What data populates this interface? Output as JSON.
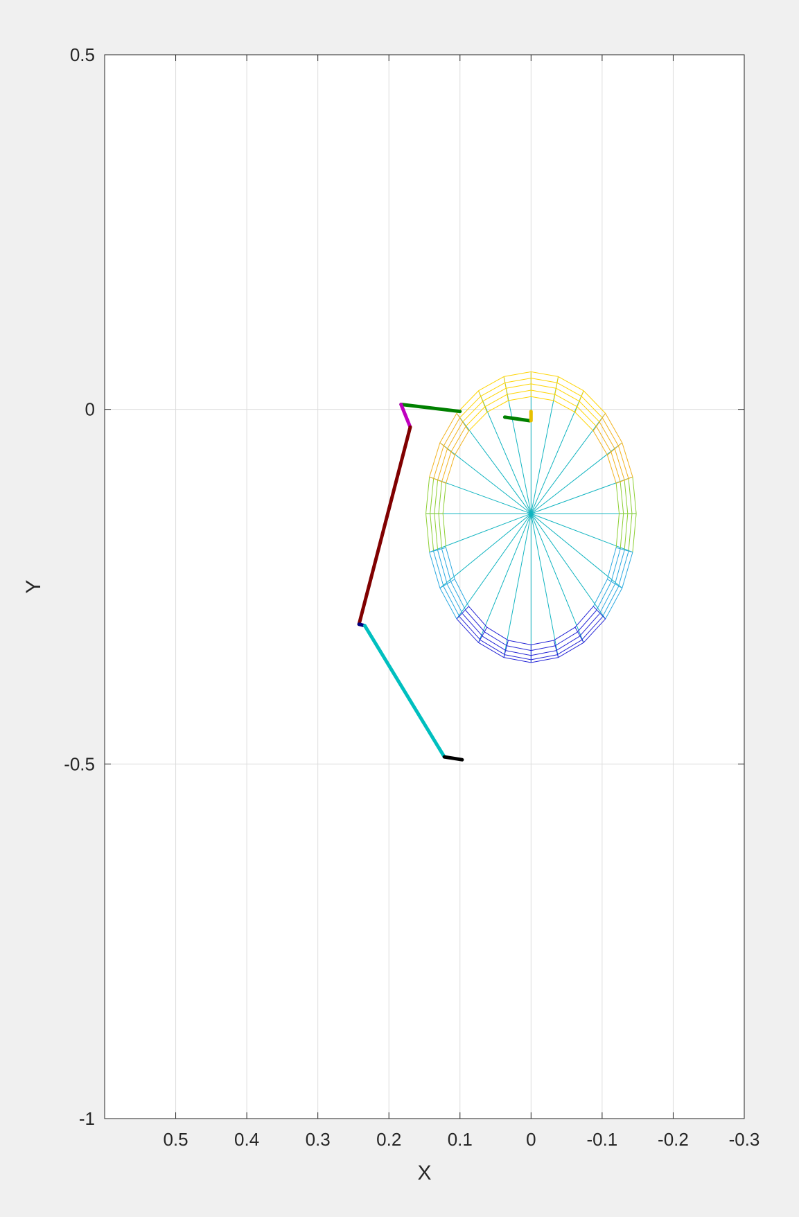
{
  "chart_data": {
    "type": "line",
    "xlabel": "X",
    "ylabel": "Y",
    "xlim": [
      -0.3,
      0.6
    ],
    "ylim": [
      -1,
      0.5
    ],
    "x_reversed": true,
    "x_ticks": [
      0.5,
      0.4,
      0.3,
      0.2,
      0.1,
      0,
      -0.1,
      -0.2,
      -0.3
    ],
    "x_tick_labels": [
      "0.5",
      "0.4",
      "0.3",
      "0.2",
      "0.1",
      "0",
      "-0.1",
      "-0.2",
      "-0.3"
    ],
    "y_ticks": [
      0.5,
      0,
      -0.5,
      -1
    ],
    "y_tick_labels": [
      "0.5",
      "0",
      "-0.5",
      "-1"
    ],
    "grid": true,
    "colors": {
      "background": "#f0f0f0",
      "axes": "#ffffff",
      "axis_line": "#262626",
      "grid": "#dcdcdc"
    },
    "segments": [
      {
        "name": "link-green-top",
        "color": "#008000",
        "width": 5,
        "points": [
          [
            0.183,
            0.007
          ],
          [
            0.1,
            -0.003
          ]
        ]
      },
      {
        "name": "link-green-small",
        "color": "#008000",
        "width": 5,
        "points": [
          [
            0.037,
            -0.011
          ],
          [
            0.002,
            -0.016
          ]
        ]
      },
      {
        "name": "link-yellow",
        "color": "#e6c000",
        "width": 5,
        "points": [
          [
            0.0,
            -0.003
          ],
          [
            0.0,
            -0.016
          ]
        ]
      },
      {
        "name": "link-magenta",
        "color": "#bf00bf",
        "width": 5,
        "points": [
          [
            0.183,
            0.007
          ],
          [
            0.17,
            -0.025
          ]
        ]
      },
      {
        "name": "link-dark-red",
        "color": "#800000",
        "width": 5,
        "points": [
          [
            0.17,
            -0.025
          ],
          [
            0.242,
            -0.303
          ]
        ]
      },
      {
        "name": "link-navy",
        "color": "#000080",
        "width": 5,
        "points": [
          [
            0.242,
            -0.303
          ],
          [
            0.234,
            -0.305
          ]
        ]
      },
      {
        "name": "link-cyan",
        "color": "#00bfbf",
        "width": 5,
        "points": [
          [
            0.234,
            -0.305
          ],
          [
            0.122,
            -0.49
          ]
        ]
      },
      {
        "name": "link-black",
        "color": "#000000",
        "width": 5,
        "points": [
          [
            0.122,
            -0.49
          ],
          [
            0.097,
            -0.494
          ]
        ]
      }
    ],
    "ellipsoid": {
      "center": [
        0,
        -0.147
      ],
      "radii_x": [
        0.148,
        0.142,
        0.136,
        0.13,
        0.124
      ],
      "radii_y_top": [
        0.2,
        0.191,
        0.183,
        0.174,
        0.165
      ],
      "radii_y_bottom": [
        0.21,
        0.206,
        0.2,
        0.193,
        0.185
      ],
      "spokes": 24,
      "spoke_color": "#10b4c0",
      "ring_segments": 24,
      "color_top": "#ffd400",
      "color_upper_mid": "#f2b21e",
      "color_mid": "#8ccf32",
      "color_lower_mid": "#2aa8e0",
      "color_bottom": "#2424d6"
    }
  }
}
